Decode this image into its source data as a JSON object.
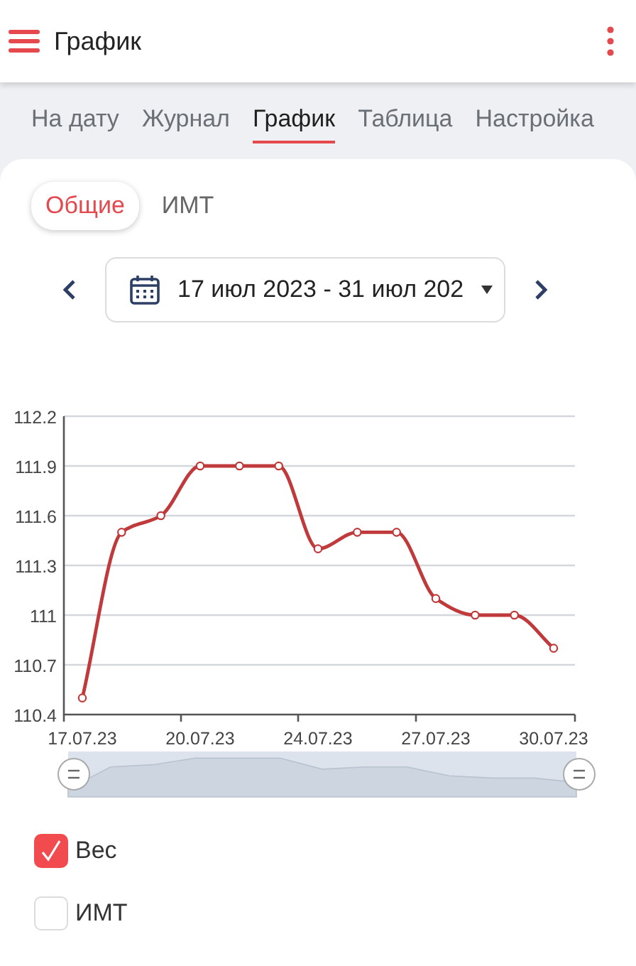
{
  "app_bar": {
    "title": "График"
  },
  "tabs": [
    {
      "label": "На дату",
      "selected": false
    },
    {
      "label": "Журнал",
      "selected": false
    },
    {
      "label": "График",
      "selected": true
    },
    {
      "label": "Таблица",
      "selected": false
    },
    {
      "label": "Настройка",
      "selected": false
    }
  ],
  "segments": [
    {
      "label": "Общие",
      "selected": true
    },
    {
      "label": "ИМТ",
      "selected": false
    }
  ],
  "date_range": {
    "value": "17 июл 2023 - 31 июл 202"
  },
  "chart_data": {
    "type": "line",
    "categories": [
      "17.07.23",
      null,
      null,
      "20.07.23",
      null,
      null,
      "24.07.23",
      null,
      null,
      "27.07.23",
      null,
      null,
      "30.07.23"
    ],
    "grid": true,
    "series": [
      {
        "color": "#c0393b",
        "marker": true,
        "values": [
          110.5,
          111.5,
          111.6,
          111.9,
          111.9,
          111.9,
          111.4,
          111.5,
          111.5,
          111.1,
          111.0,
          111.0,
          110.8
        ]
      }
    ],
    "ylim": [
      110.4,
      112.2
    ],
    "yticks": [
      110.4,
      110.7,
      111,
      111.3,
      111.6,
      111.9,
      112.2
    ]
  },
  "series_toggles": [
    {
      "label": "Вес",
      "checked": true
    },
    {
      "label": "ИМТ",
      "checked": false
    }
  ]
}
